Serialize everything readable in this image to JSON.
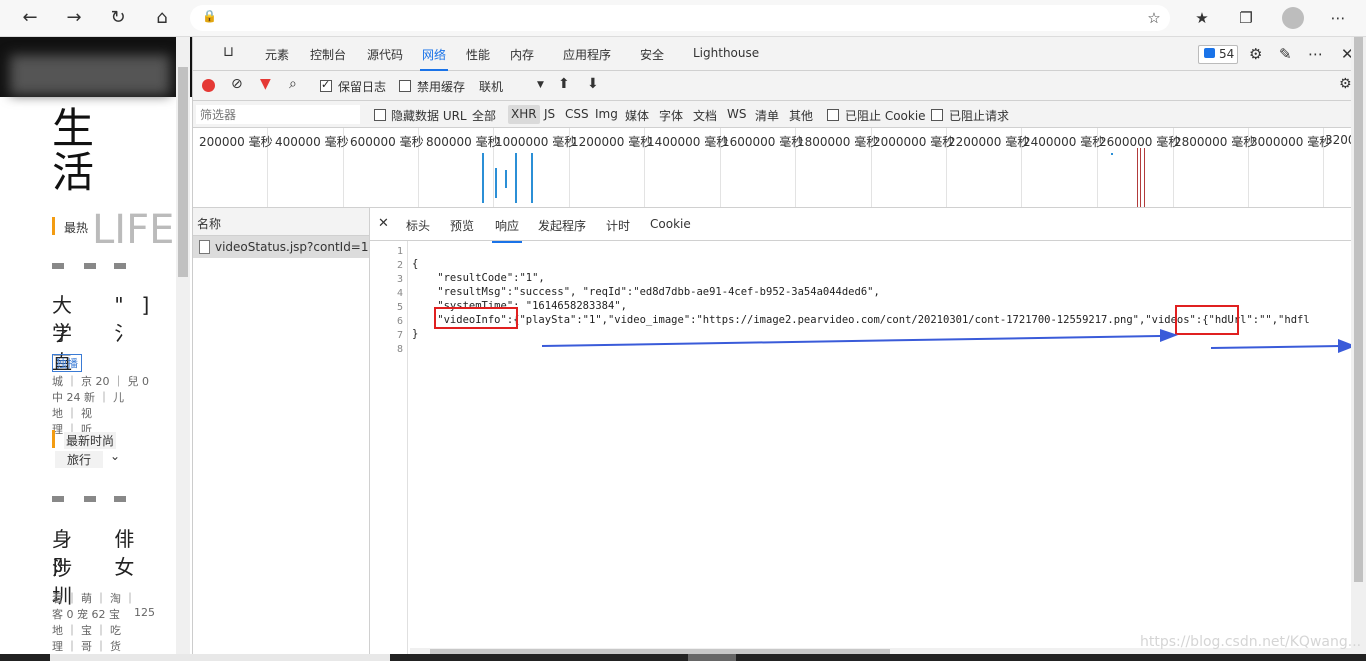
{
  "browser": {
    "back_icon": "back-arrow-icon",
    "forward_icon": "forward-arrow-icon"
  },
  "devtools": {
    "tabs": [
      "元素",
      "控制台",
      "源代码",
      "网络",
      "性能",
      "内存",
      "应用程序",
      "安全",
      "Lighthouse"
    ],
    "active_tab": "网络",
    "issues_count": "54",
    "toolbar": {
      "preserve_log": "保留日志",
      "disable_cache": "禁用缓存",
      "throttle": "联机"
    },
    "filter": {
      "placeholder": "筛选器",
      "hide_data_url": "隐藏数据 URL",
      "types": [
        "全部",
        "XHR",
        "JS",
        "CSS",
        "Img",
        "媒体",
        "字体",
        "文档",
        "WS",
        "清单",
        "其他"
      ],
      "selected_type": "XHR",
      "blocked_cookies": "已阻止 Cookie",
      "blocked_requests": "已阻止请求"
    },
    "timeline_labels": [
      "200000 毫秒",
      "400000 毫秒",
      "600000 毫秒",
      "800000 毫秒",
      "1000000 毫秒",
      "1200000 毫秒",
      "1400000 毫秒",
      "1600000 毫秒",
      "1800000 毫秒",
      "2000000 毫秒",
      "2200000 毫秒",
      "2400000 毫秒",
      "2600000 毫秒",
      "2800000 毫秒",
      "3000000 毫秒",
      "3200"
    ],
    "request_list": {
      "header": "名称",
      "row": "videoStatus.jsp?contId=1..."
    },
    "detail_tabs": [
      "标头",
      "预览",
      "响应",
      "发起程序",
      "计时",
      "Cookie"
    ],
    "detail_active": "响应",
    "response": {
      "line_numbers": [
        "1",
        "2",
        "3",
        "4",
        "5",
        "6",
        "7",
        "8"
      ],
      "lines": [
        "",
        "{",
        "    \"resultCode\":\"1\",",
        "    \"resultMsg\":\"success\", \"reqId\":\"ed8d7dbb-ae91-4cef-b952-3a54a044ded6\",",
        "    \"systemTime\": \"1614658283384\",",
        "    \"videoInfo\":{\"playSta\":\"1\",\"video_image\":\"https://image2.pearvideo.com/cont/20210301/cont-1721700-12559217.png\",\"videos\":{\"hdUrl\":\"\",\"hdfl",
        "}",
        ""
      ]
    }
  },
  "left_page": {
    "big_title_1": "生",
    "big_title_2": "活",
    "life": "LIFE",
    "tab_hot": "最热",
    "exclusive": "独播",
    "tab_new": "最新",
    "tab_fashion": "时尚",
    "tab_travel": "旅行",
    "small_125": "125"
  },
  "watermark": "https://blog.csdn.net/KQwang..."
}
